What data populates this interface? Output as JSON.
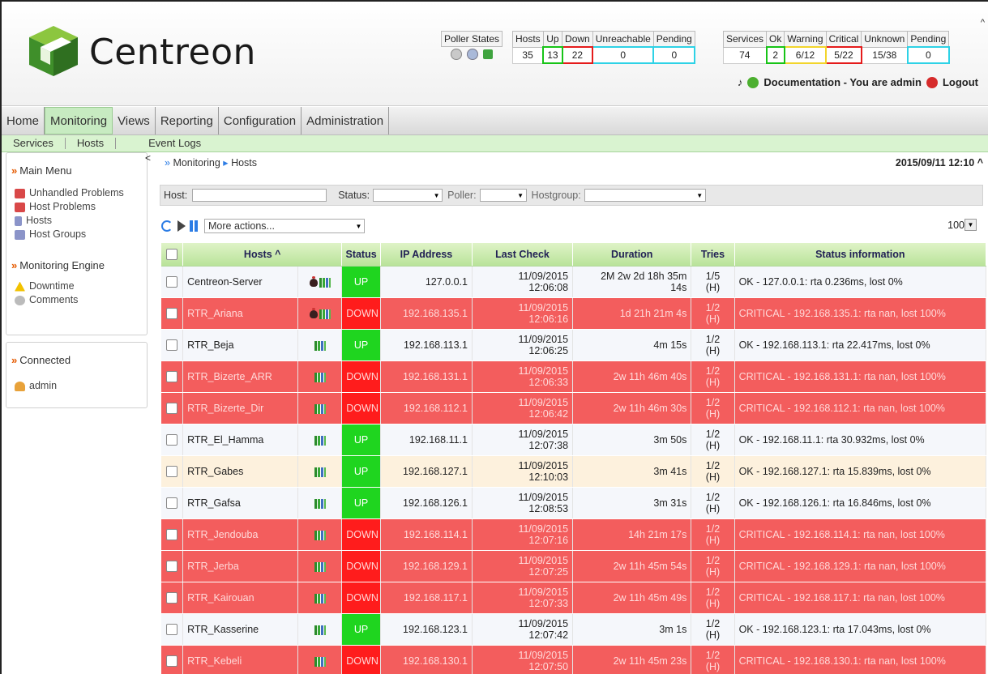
{
  "app": {
    "logo_text": "Centreon"
  },
  "stats": {
    "poller_states_label": "Poller States",
    "hosts_headers": [
      "Hosts",
      "Up",
      "Down",
      "Unreachable",
      "Pending"
    ],
    "hosts_values": [
      "35",
      "13",
      "22",
      "0",
      "0"
    ],
    "services_headers": [
      "Services",
      "Ok",
      "Warning",
      "Critical",
      "Unknown",
      "Pending"
    ],
    "services_values": [
      "74",
      "2",
      "6/12",
      "5/22",
      "15/38",
      "0"
    ]
  },
  "userbar": {
    "text": "Documentation - You are admin",
    "logout": "Logout"
  },
  "menu": [
    "Home",
    "Monitoring",
    "Views",
    "Reporting",
    "Configuration",
    "Administration"
  ],
  "submenu": [
    "Services",
    "Hosts",
    "Event Logs"
  ],
  "left": {
    "main_menu": "Main Menu",
    "main_items": [
      "Unhandled Problems",
      "Host Problems",
      "Hosts",
      "Host Groups"
    ],
    "engine": "Monitoring Engine",
    "engine_items": [
      "Downtime",
      "Comments"
    ],
    "connected": "Connected",
    "user": "admin"
  },
  "breadcrumb": [
    "Monitoring",
    "Hosts"
  ],
  "datetime": "2015/09/11 12:10",
  "filters": {
    "host": "Host:",
    "status": "Status:",
    "poller": "Poller:",
    "hostgroup": "Hostgroup:"
  },
  "actions": {
    "more": "More actions...",
    "per_page": "100"
  },
  "table": {
    "headers": [
      "Hosts ^",
      "Status",
      "IP Address",
      "Last Check",
      "Duration",
      "Tries",
      "Status information"
    ],
    "rows": [
      {
        "host": "Centreon-Server",
        "bug": true,
        "status": "UP",
        "ip": "127.0.0.1",
        "date": "11/09/2015",
        "time": "12:06:08",
        "duration": "2M 2w 2d 18h 35m",
        "duration2": "14s",
        "tries": "1/5",
        "tries2": "(H)",
        "info": "OK - 127.0.0.1: rta 0.236ms, lost 0%",
        "cls": "ok"
      },
      {
        "host": "RTR_Ariana",
        "bug": true,
        "status": "DOWN",
        "ip": "192.168.135.1",
        "date": "11/09/2015",
        "time": "12:06:16",
        "duration": "1d 21h 21m 4s",
        "duration2": "",
        "tries": "1/2",
        "tries2": "(H)",
        "info": "CRITICAL - 192.168.135.1: rta nan, lost 100%",
        "cls": "crit"
      },
      {
        "host": "RTR_Beja",
        "bug": false,
        "status": "UP",
        "ip": "192.168.113.1",
        "date": "11/09/2015",
        "time": "12:06:25",
        "duration": "4m 15s",
        "duration2": "",
        "tries": "1/2",
        "tries2": "(H)",
        "info": "OK - 192.168.113.1: rta 22.417ms, lost 0%",
        "cls": "ok"
      },
      {
        "host": "RTR_Bizerte_ARR",
        "bug": false,
        "status": "DOWN",
        "ip": "192.168.131.1",
        "date": "11/09/2015",
        "time": "12:06:33",
        "duration": "2w 11h 46m 40s",
        "duration2": "",
        "tries": "1/2",
        "tries2": "(H)",
        "info": "CRITICAL - 192.168.131.1: rta nan, lost 100%",
        "cls": "crit"
      },
      {
        "host": "RTR_Bizerte_Dir",
        "bug": false,
        "status": "DOWN",
        "ip": "192.168.112.1",
        "date": "11/09/2015",
        "time": "12:06:42",
        "duration": "2w 11h 46m 30s",
        "duration2": "",
        "tries": "1/2",
        "tries2": "(H)",
        "info": "CRITICAL - 192.168.112.1: rta nan, lost 100%",
        "cls": "crit"
      },
      {
        "host": "RTR_El_Hamma",
        "bug": false,
        "status": "UP",
        "ip": "192.168.11.1",
        "date": "11/09/2015",
        "time": "12:07:38",
        "duration": "3m 50s",
        "duration2": "",
        "tries": "1/2",
        "tries2": "(H)",
        "info": "OK - 192.168.11.1: rta 30.932ms, lost 0%",
        "cls": "ok"
      },
      {
        "host": "RTR_Gabes",
        "bug": false,
        "status": "UP",
        "ip": "192.168.127.1",
        "date": "11/09/2015",
        "time": "12:10:03",
        "duration": "3m 41s",
        "duration2": "",
        "tries": "1/2",
        "tries2": "(H)",
        "info": "OK - 192.168.127.1: rta 15.839ms, lost 0%",
        "cls": "okh"
      },
      {
        "host": "RTR_Gafsa",
        "bug": false,
        "status": "UP",
        "ip": "192.168.126.1",
        "date": "11/09/2015",
        "time": "12:08:53",
        "duration": "3m 31s",
        "duration2": "",
        "tries": "1/2",
        "tries2": "(H)",
        "info": "OK - 192.168.126.1: rta 16.846ms, lost 0%",
        "cls": "ok"
      },
      {
        "host": "RTR_Jendouba",
        "bug": false,
        "status": "DOWN",
        "ip": "192.168.114.1",
        "date": "11/09/2015",
        "time": "12:07:16",
        "duration": "14h 21m 17s",
        "duration2": "",
        "tries": "1/2",
        "tries2": "(H)",
        "info": "CRITICAL - 192.168.114.1: rta nan, lost 100%",
        "cls": "crit"
      },
      {
        "host": "RTR_Jerba",
        "bug": false,
        "status": "DOWN",
        "ip": "192.168.129.1",
        "date": "11/09/2015",
        "time": "12:07:25",
        "duration": "2w 11h 45m 54s",
        "duration2": "",
        "tries": "1/2",
        "tries2": "(H)",
        "info": "CRITICAL - 192.168.129.1: rta nan, lost 100%",
        "cls": "crit"
      },
      {
        "host": "RTR_Kairouan",
        "bug": false,
        "status": "DOWN",
        "ip": "192.168.117.1",
        "date": "11/09/2015",
        "time": "12:07:33",
        "duration": "2w 11h 45m 49s",
        "duration2": "",
        "tries": "1/2",
        "tries2": "(H)",
        "info": "CRITICAL - 192.168.117.1: rta nan, lost 100%",
        "cls": "crit"
      },
      {
        "host": "RTR_Kasserine",
        "bug": false,
        "status": "UP",
        "ip": "192.168.123.1",
        "date": "11/09/2015",
        "time": "12:07:42",
        "duration": "3m 1s",
        "duration2": "",
        "tries": "1/2",
        "tries2": "(H)",
        "info": "OK - 192.168.123.1: rta 17.043ms, lost 0%",
        "cls": "ok"
      },
      {
        "host": "RTR_Kebeli",
        "bug": false,
        "status": "DOWN",
        "ip": "192.168.130.1",
        "date": "11/09/2015",
        "time": "12:07:50",
        "duration": "2w 11h 45m 23s",
        "duration2": "",
        "tries": "1/2",
        "tries2": "(H)",
        "info": "CRITICAL - 192.168.130.1: rta nan, lost 100%",
        "cls": "crit"
      }
    ]
  }
}
